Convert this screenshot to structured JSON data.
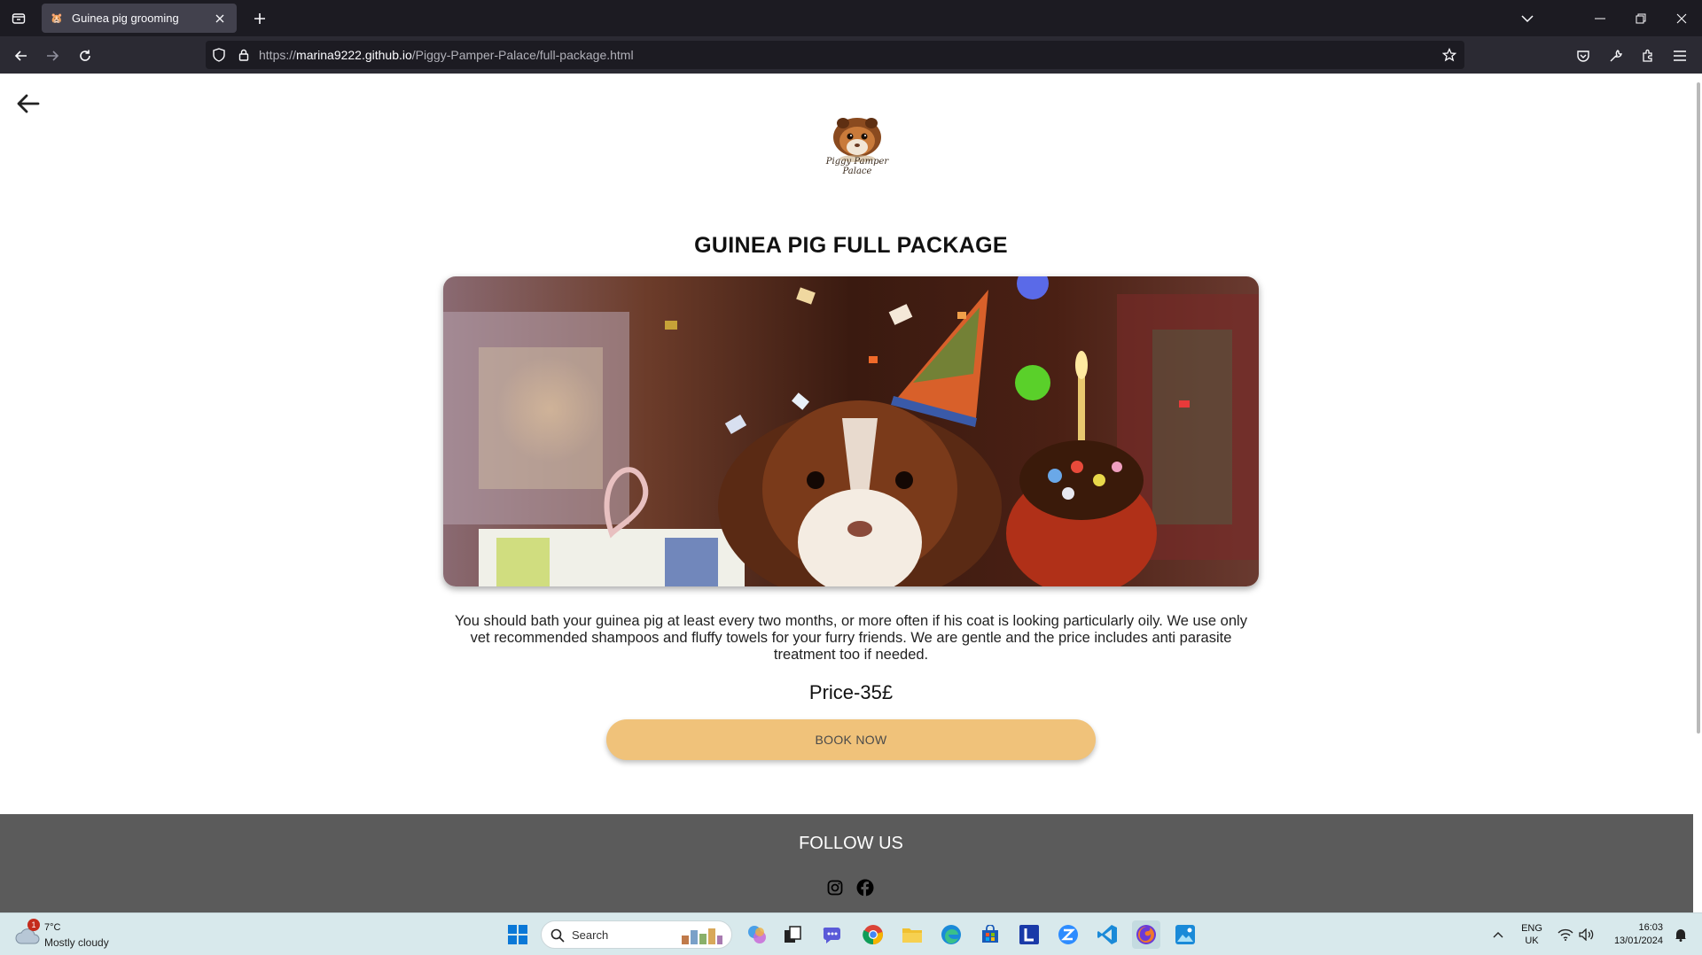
{
  "browser": {
    "tab_title": "Guinea pig grooming",
    "url_prefix": "https://",
    "url_host": "marina9222.github.io",
    "url_path": "/Piggy-Pamper-Palace/full-package.html"
  },
  "page": {
    "logo_text_line1": "Piggy Pamper",
    "logo_text_line2": "Palace",
    "title": "GUINEA PIG FULL PACKAGE",
    "description": "You should bath your guinea pig at least every two months, or more often if his coat is looking particularly oily. We use only vet recommended shampoos and fluffy towels for your furry friends. We are gentle and the price includes anti parasite treatment too if needed.",
    "price": "Price-35£",
    "book_button": "BOOK NOW"
  },
  "footer": {
    "follow_label": "FOLLOW US",
    "social_icons": [
      "instagram-icon",
      "facebook-icon"
    ]
  },
  "taskbar": {
    "weather_temp": "7°C",
    "weather_desc": "Mostly cloudy",
    "weather_badge": "1",
    "search_placeholder": "Search",
    "lang_line1": "ENG",
    "lang_line2": "UK",
    "time": "16:03",
    "date": "13/01/2024"
  },
  "colors": {
    "button": "#f0c27a",
    "footer": "#5b5b5b",
    "taskbar": "#d8e9ec"
  }
}
